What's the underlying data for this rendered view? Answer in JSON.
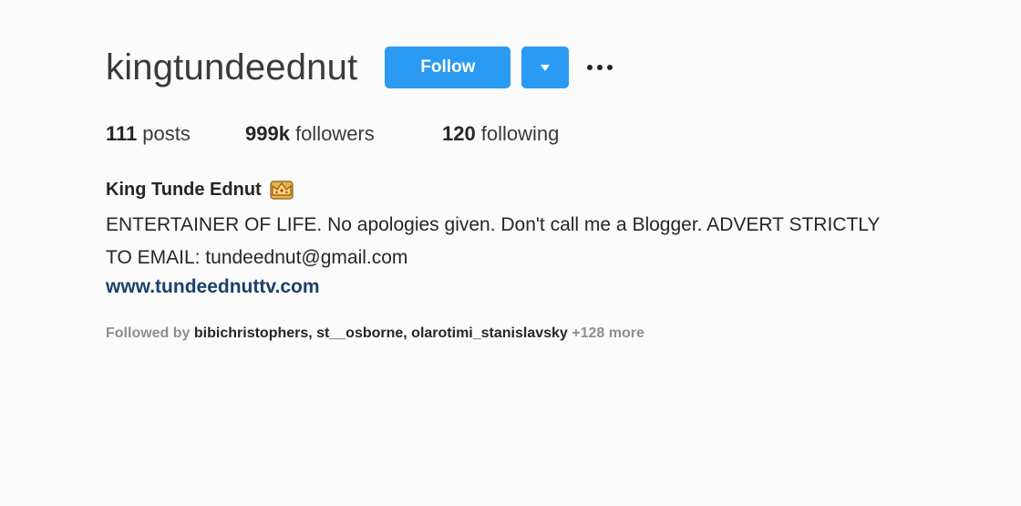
{
  "profile": {
    "username": "kingtundeednut",
    "follow_label": "Follow",
    "full_name": "King Tunde Ednut",
    "crown_emoji": "👑",
    "bio_line1": "ENTERTAINER OF LIFE. No apologies given. Don't call me a Blogger. ADVERT STRICTLY",
    "bio_line2": "TO EMAIL: tundeednut@gmail.com",
    "website": "www.tundeednuttv.com"
  },
  "stats": {
    "posts_count": "111",
    "posts_label": "posts",
    "followers_count": "999k",
    "followers_label": "followers",
    "following_count": "120",
    "following_label": "following"
  },
  "followed_by": {
    "prefix": "Followed by",
    "names": "bibichristophers, st__osborne, olarotimi_stanislavsky",
    "more": "+128 more"
  },
  "colors": {
    "accent": "#2b9af3",
    "link": "#1c3f6b",
    "muted": "#8e8e8e"
  },
  "icons": {
    "dropdown": "chevron-down-icon",
    "more": "more-options-icon",
    "crown": "crown-icon"
  }
}
